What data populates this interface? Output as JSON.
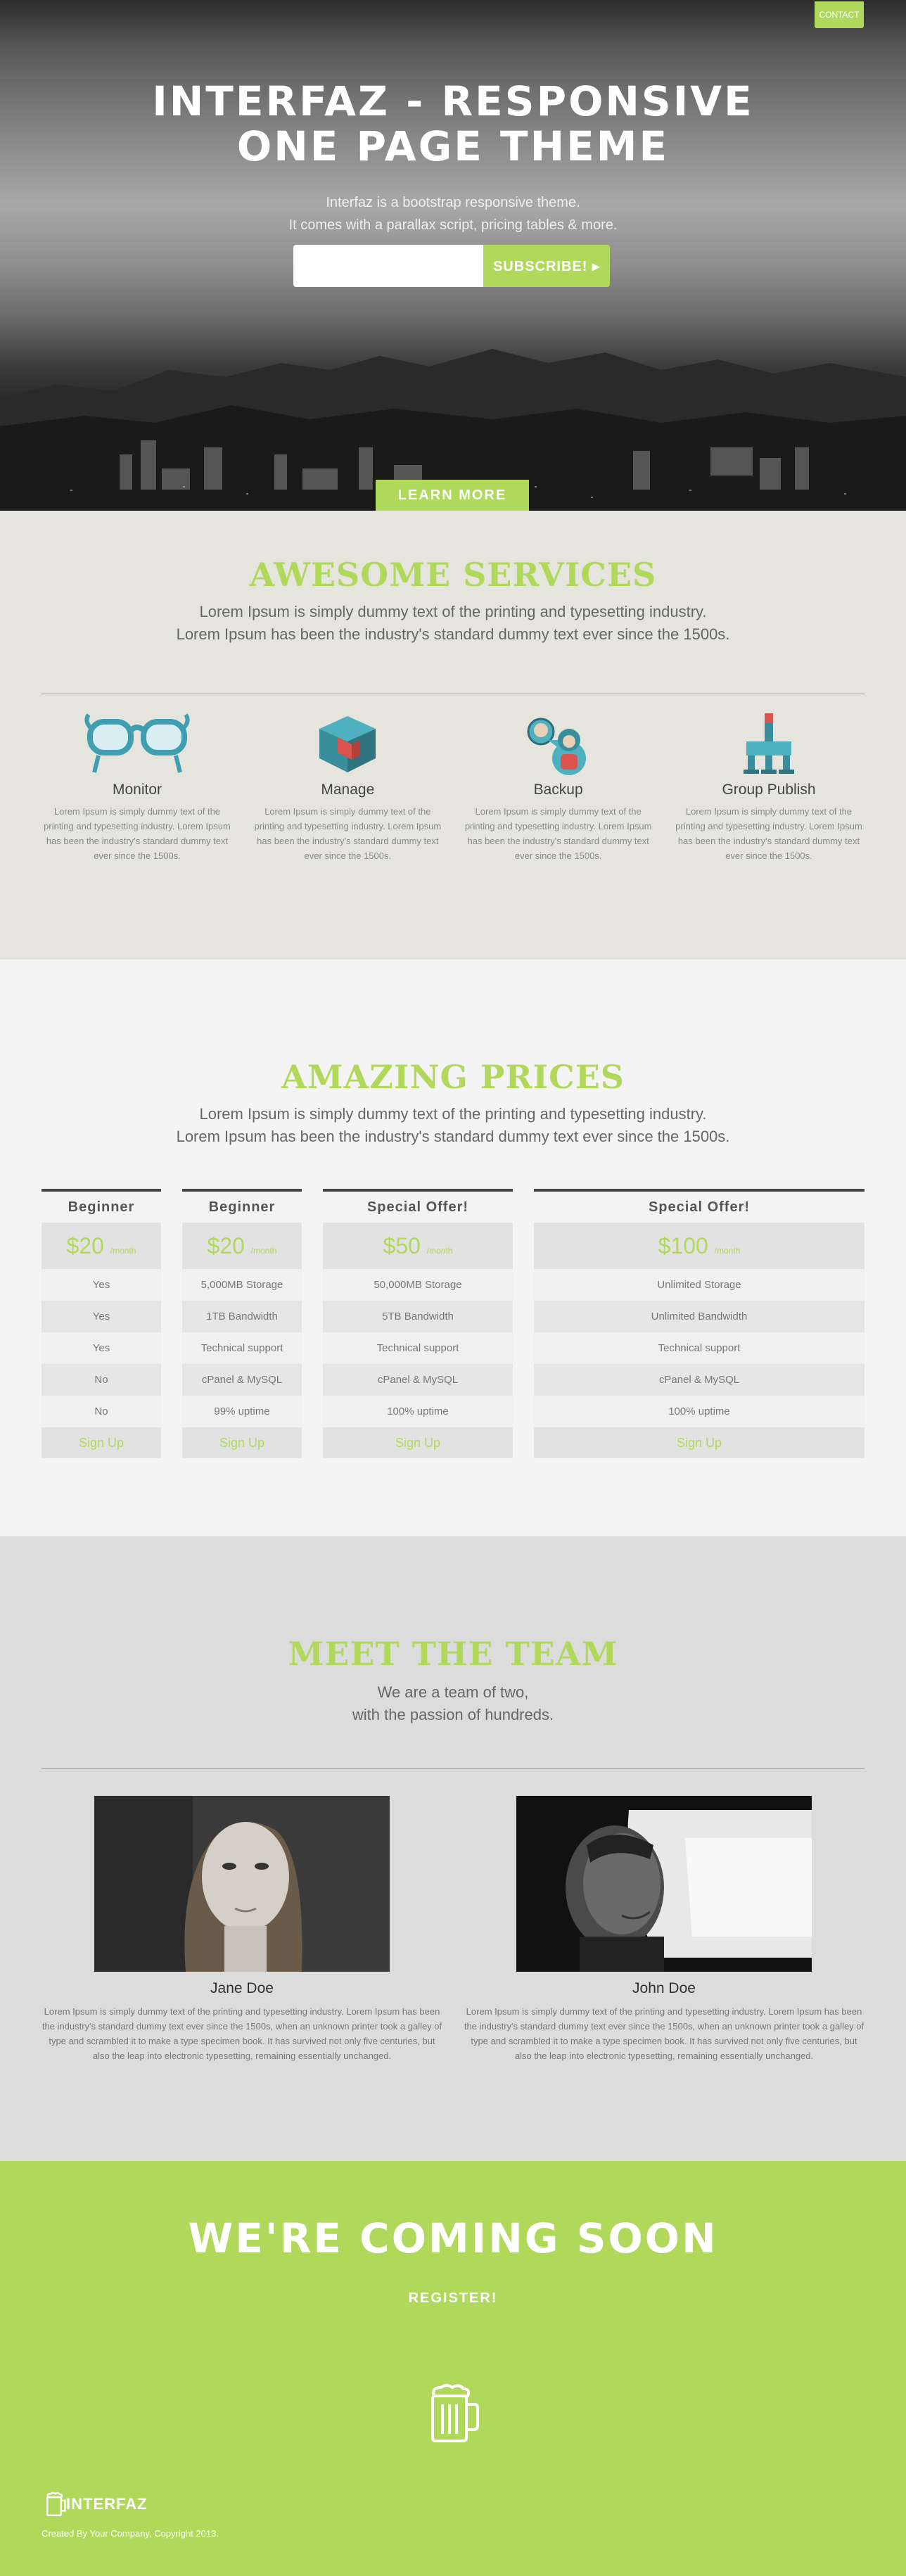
{
  "header": {
    "contact_label": "CONTACT"
  },
  "hero": {
    "title_line1": "INTERFAZ - RESPONSIVE",
    "title_line2": "ONE PAGE THEME",
    "subtitle_line1": "Interfaz is a bootstrap responsive theme.",
    "subtitle_line2": "It comes with a parallax script, pricing tables & more.",
    "email_value": "",
    "subscribe_label": "SUBSCRIBE! ▸",
    "learn_more_label": "LEARN MORE"
  },
  "services": {
    "title": "AWESOME SERVICES",
    "subtitle_line1": "Lorem Ipsum is simply dummy text of the printing and typesetting industry.",
    "subtitle_line2": "Lorem Ipsum has been the industry's standard dummy text ever since the 1500s.",
    "items": [
      {
        "name": "Monitor",
        "icon": "glasses-icon",
        "text": "Lorem Ipsum is simply dummy text of the printing and typesetting industry. Lorem Ipsum has been the industry's standard dummy text ever since the 1500s."
      },
      {
        "name": "Manage",
        "icon": "cubes-icon",
        "text": "Lorem Ipsum is simply dummy text of the printing and typesetting industry. Lorem Ipsum has been the industry's standard dummy text ever since the 1500s."
      },
      {
        "name": "Backup",
        "icon": "people-icon",
        "text": "Lorem Ipsum is simply dummy text of the printing and typesetting industry. Lorem Ipsum has been the industry's standard dummy text ever since the 1500s."
      },
      {
        "name": "Group Publish",
        "icon": "network-icon",
        "text": "Lorem Ipsum is simply dummy text of the printing and typesetting industry. Lorem Ipsum has been the industry's standard dummy text ever since the 1500s."
      }
    ]
  },
  "prices": {
    "title": "AMAZING PRICES",
    "subtitle_line1": "Lorem Ipsum is simply dummy text of the printing and typesetting industry.",
    "subtitle_line2": "Lorem Ipsum has been the industry's standard dummy text ever since the 1500s.",
    "tables": [
      {
        "name": "Beginner",
        "price": "$20",
        "unit": "/month",
        "rows": [
          "Yes",
          "Yes",
          "Yes",
          "No",
          "No"
        ],
        "signup": "Sign Up"
      },
      {
        "name": "Beginner",
        "price": "$20",
        "unit": "/month",
        "rows": [
          "5,000MB Storage",
          "1TB Bandwidth",
          "Technical support",
          "cPanel & MySQL",
          "99% uptime"
        ],
        "signup": "Sign Up"
      },
      {
        "name": "Special Offer!",
        "price": "$50",
        "unit": "/month",
        "rows": [
          "50,000MB Storage",
          "5TB Bandwidth",
          "Technical support",
          "cPanel & MySQL",
          "100% uptime"
        ],
        "signup": "Sign Up"
      },
      {
        "name": "Special Offer!",
        "price": "$100",
        "unit": "/month",
        "rows": [
          "Unlimited Storage",
          "Unlimited Bandwidth",
          "Technical support",
          "cPanel & MySQL",
          "100% uptime"
        ],
        "signup": "Sign Up"
      }
    ]
  },
  "team": {
    "title": "MEET THE TEAM",
    "subtitle_line1": "We are a team of two,",
    "subtitle_line2": "with the passion of hundreds.",
    "members": [
      {
        "name": "Jane Doe",
        "bio": "Lorem Ipsum is simply dummy text of the printing and typesetting industry. Lorem Ipsum has been the industry's standard dummy text ever since the 1500s, when an unknown printer took a galley of type and scrambled it to make a type specimen book. It has survived not only five centuries, but also the leap into electronic typesetting, remaining essentially unchanged."
      },
      {
        "name": "John Doe",
        "bio": "Lorem Ipsum is simply dummy text of the printing and typesetting industry. Lorem Ipsum has been the industry's standard dummy text ever since the 1500s, when an unknown printer took a galley of type and scrambled it to make a type specimen book. It has survived not only five centuries, but also the leap into electronic typesetting, remaining essentially unchanged."
      }
    ]
  },
  "footer": {
    "title": "WE'RE COMING SOON",
    "register_label": "REGISTER!",
    "logo_text": "INTERFAZ",
    "copyright": "Created By Your Company, Copyright 2013."
  },
  "colors": {
    "accent": "#b0d95c",
    "services_bg": "#e5e5de",
    "prices_bg": "#f4f4f4",
    "team_bg": "#dcdcdc"
  }
}
